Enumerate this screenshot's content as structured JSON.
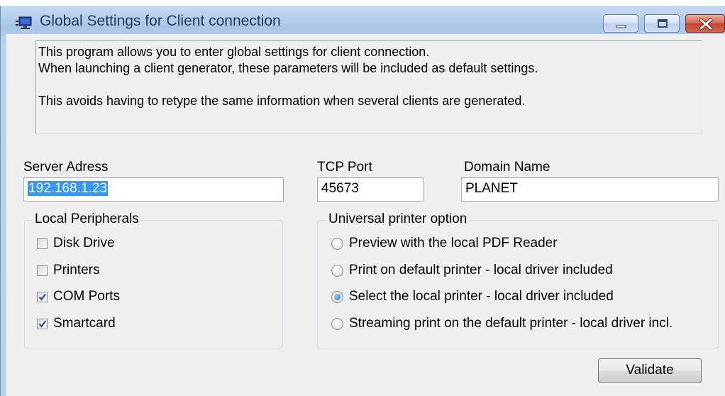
{
  "window": {
    "title": "Global Settings for Client connection"
  },
  "info": {
    "line1": "This program allows you to enter global settings for client connection.",
    "line2": "When launching a client generator, these parameters will be included as default settings.",
    "line3": "This avoids having to retype the same information when several clients are generated."
  },
  "server": {
    "label": "Server Adress",
    "value": "192.168.1.23"
  },
  "tcp": {
    "label": "TCP Port",
    "value": "45673"
  },
  "domain": {
    "label": "Domain Name",
    "value": "PLANET"
  },
  "peripherals": {
    "title": "Local Peripherals",
    "items": [
      {
        "label": "Disk Drive",
        "checked": false
      },
      {
        "label": "Printers",
        "checked": false
      },
      {
        "label": "COM Ports",
        "checked": true
      },
      {
        "label": "Smartcard",
        "checked": true
      }
    ]
  },
  "printer": {
    "title": "Universal printer option",
    "options": [
      {
        "label": "Preview with the local PDF Reader",
        "selected": false
      },
      {
        "label": "Print on default printer - local driver included",
        "selected": false
      },
      {
        "label": "Select the local printer - local driver included",
        "selected": true
      },
      {
        "label": "Streaming print on the default printer - local driver incl.",
        "selected": false
      }
    ]
  },
  "validate_label": "Validate",
  "icons": {
    "app": "monitor-network-icon",
    "minimize": "minimize-icon",
    "maximize": "maximize-icon",
    "close": "close-icon"
  }
}
